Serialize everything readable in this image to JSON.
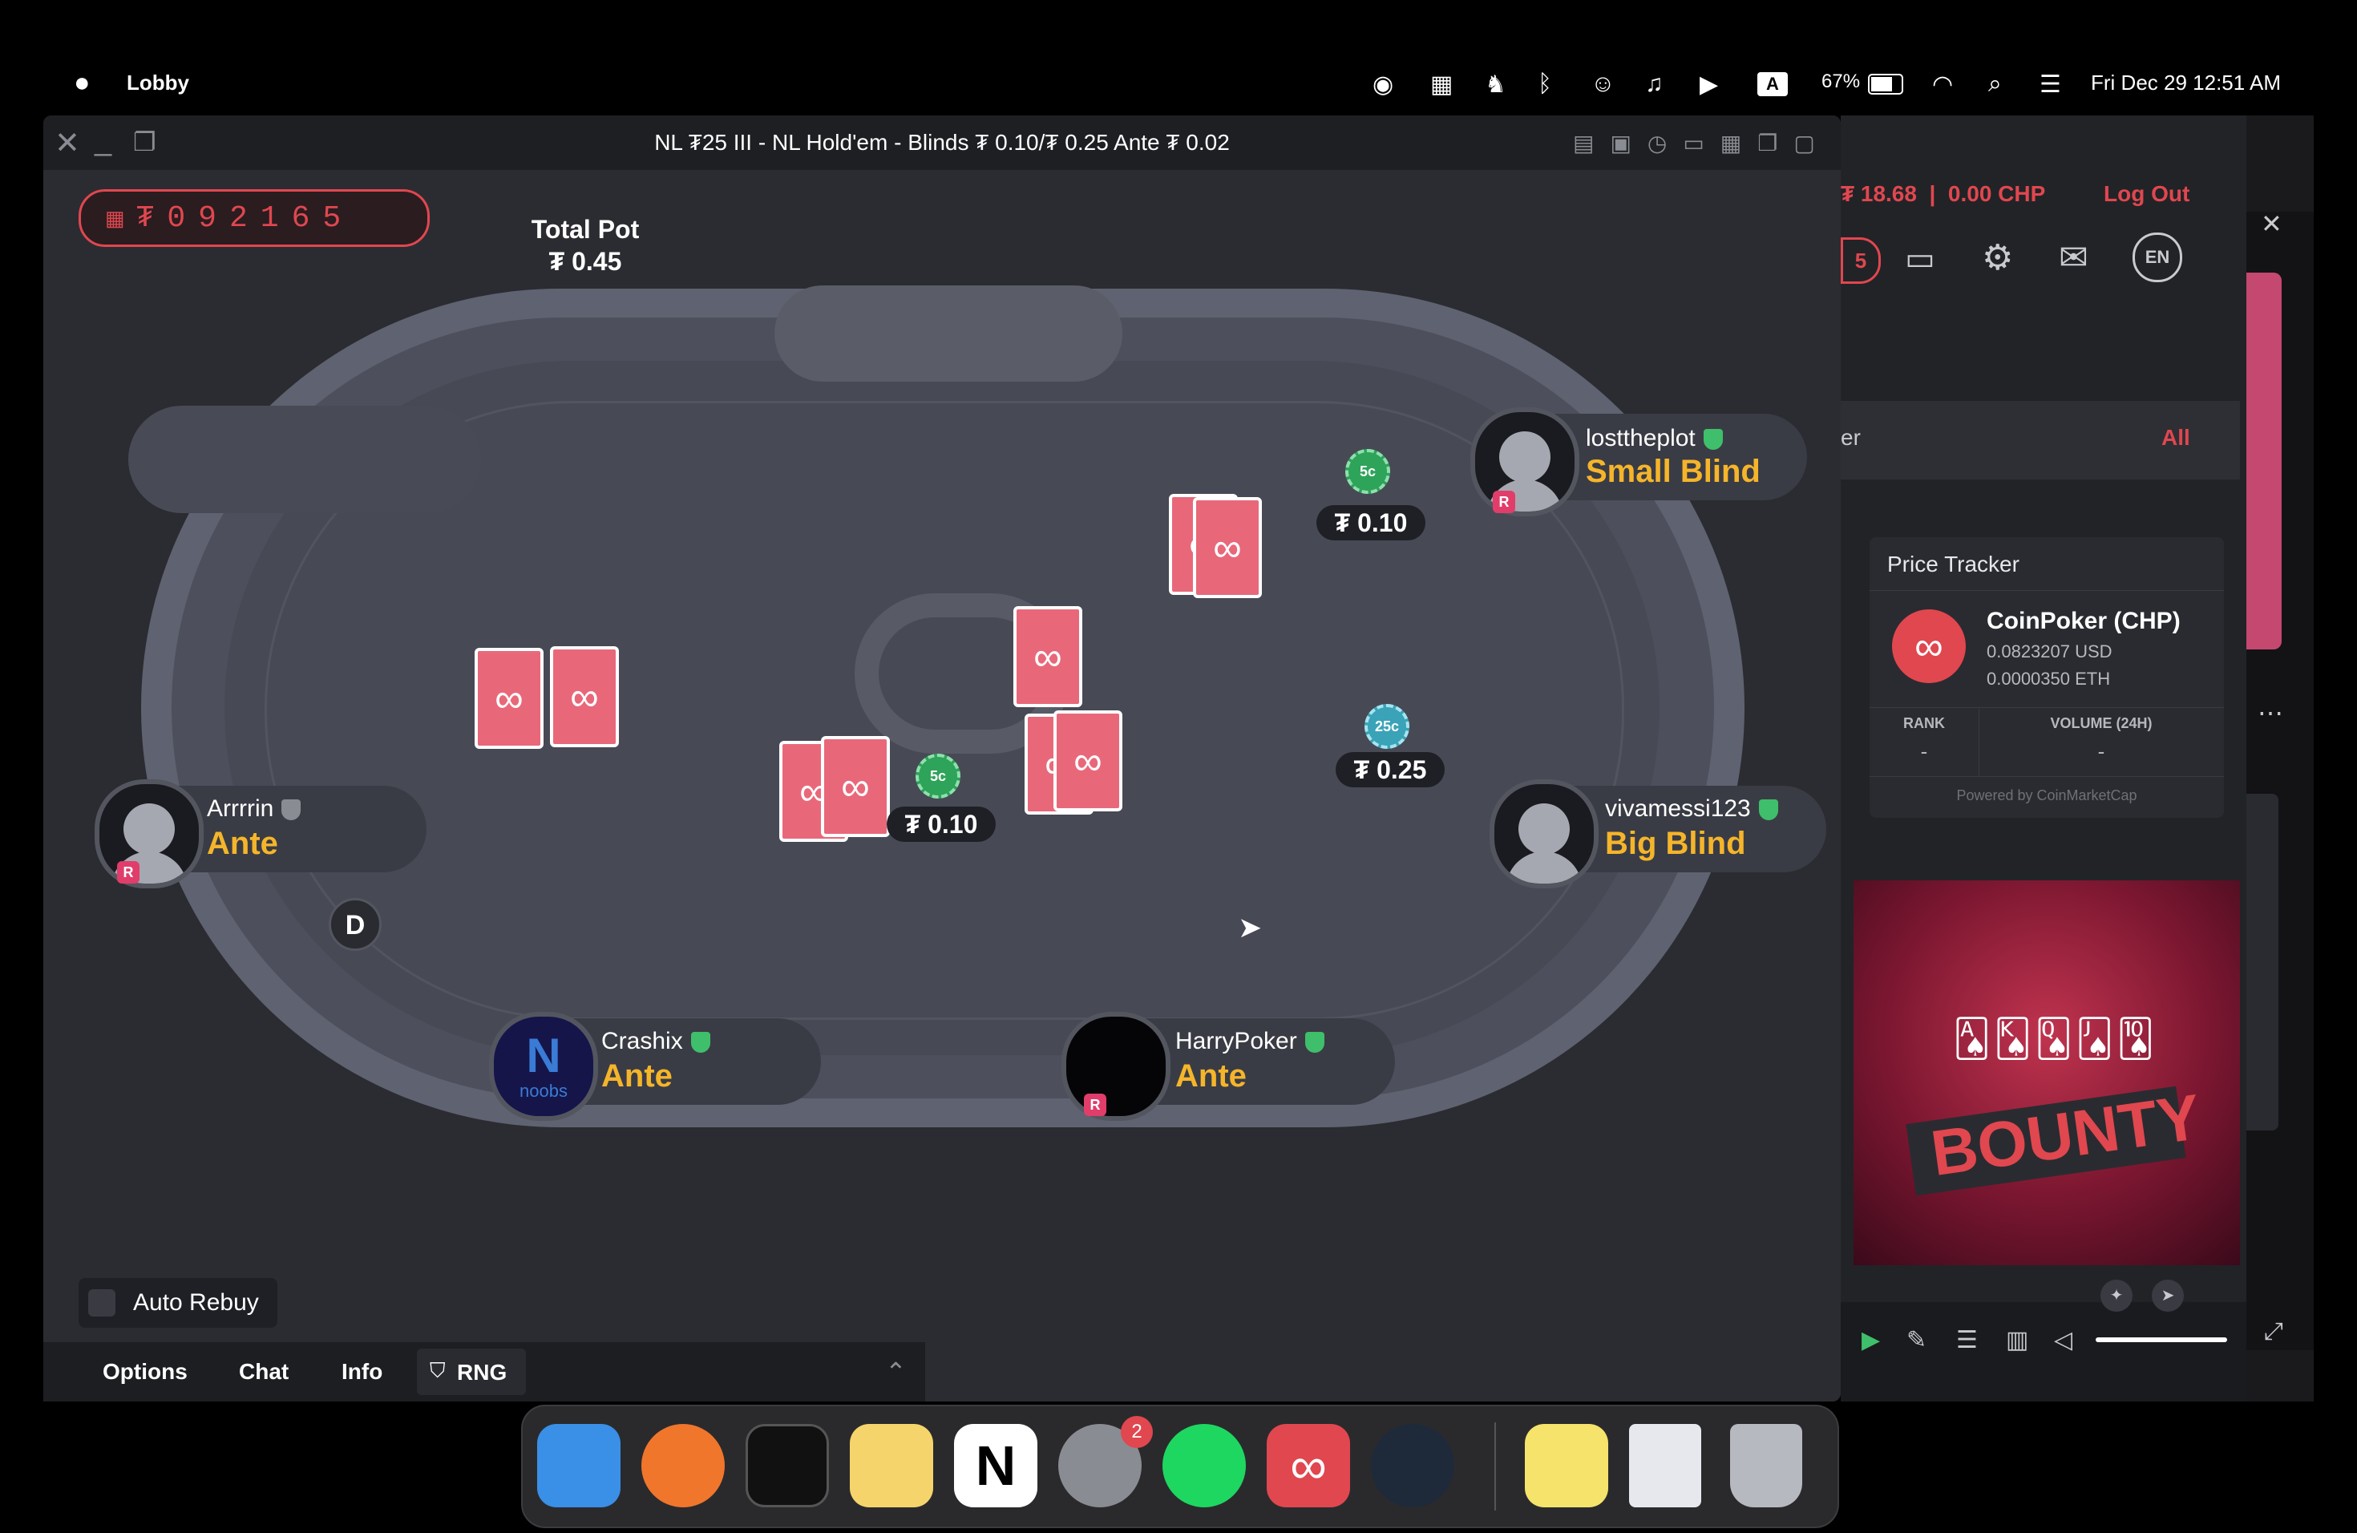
{
  "menubar": {
    "app_name": "Lobby",
    "battery": "67%",
    "datetime": "Fri Dec 29  12:51 AM",
    "input_badge": "A"
  },
  "window": {
    "title": "NL ₮25 III - NL Hold'em - Blinds ₮ 0.10/₮ 0.25 Ante ₮ 0.02"
  },
  "jackpot": {
    "digits": "₮092165"
  },
  "pot": {
    "label": "Total Pot",
    "value": "₮ 0.45"
  },
  "players": {
    "p1": {
      "name": "losttheplot",
      "action": "Small Blind"
    },
    "p2": {
      "name": "vivamessi123",
      "action": "Big Blind"
    },
    "p3": {
      "name": "Arrrrin",
      "action": "Ante"
    },
    "p4": {
      "name": "Crashix",
      "action": "Ante"
    },
    "p5": {
      "name": "HarryPoker",
      "action": "Ante"
    }
  },
  "bets": {
    "b1": {
      "chip": "5c",
      "amount": "₮ 0.10"
    },
    "b2": {
      "chip": "25c",
      "amount": "₮ 0.25"
    },
    "b3": {
      "chip": "5c",
      "amount": "₮ 0.10"
    }
  },
  "dealer_button": "D",
  "bottom": {
    "auto_rebuy": "Auto Rebuy",
    "tabs": [
      "Options",
      "Chat",
      "Info",
      "RNG"
    ]
  },
  "right_panel": {
    "balance": "₮ 18.68  |  0.00 CHP",
    "logout": "Log Out",
    "lang": "EN",
    "notif_count": "5",
    "filter_fragment": "er",
    "filter_all": "All",
    "price_tracker": {
      "title": "Price Tracker",
      "coin": "CoinPoker (CHP)",
      "usd": "0.0823207 USD",
      "eth": "0.0000350 ETH",
      "rank_label": "RANK",
      "rank_value": "-",
      "volume_label": "VOLUME (24H)",
      "volume_value": "-",
      "powered": "Powered by CoinMarketCap"
    },
    "banner_text": "BOUNTY"
  },
  "dock": {
    "settings_badge": "2"
  },
  "colors": {
    "accent_red": "#e0474f",
    "action_gold": "#f5b52a",
    "verified_green": "#3fbf6b"
  }
}
